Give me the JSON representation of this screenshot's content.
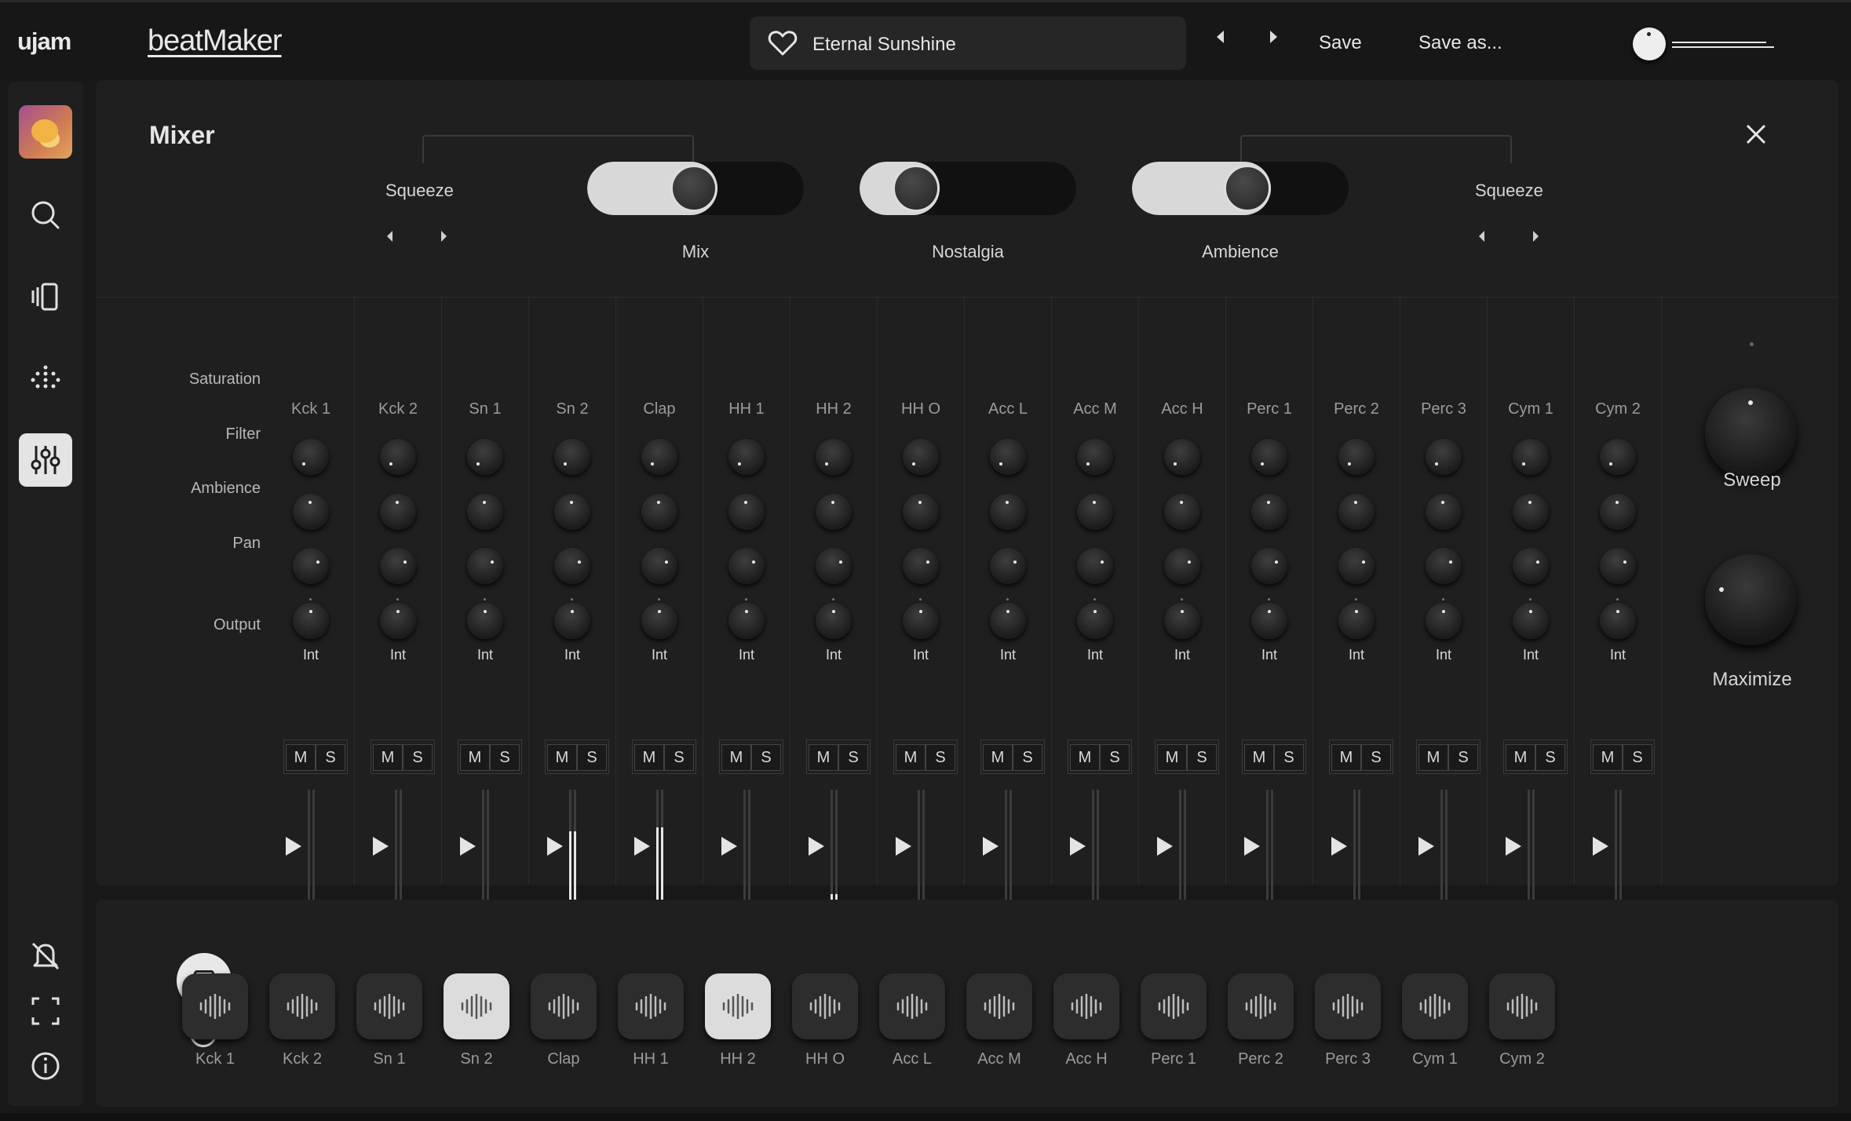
{
  "app": {
    "brand": "ujam",
    "product": "beatMaker"
  },
  "header": {
    "preset_name": "Eternal Sunshine",
    "save_label": "Save",
    "save_as_label": "Save as..."
  },
  "sidebar": {
    "items": [
      "search-icon",
      "library-icon",
      "pattern-icon",
      "mixer-icon"
    ],
    "active": "mixer-icon",
    "bottom_items": [
      "notifications-off-icon",
      "fullscreen-icon",
      "info-icon"
    ]
  },
  "mixer": {
    "title": "Mixer",
    "left_squeeze_label": "Squeeze",
    "right_squeeze_label": "Squeeze",
    "toggles": [
      {
        "label": "Mix",
        "fill_fraction": 0.5
      },
      {
        "label": "Nostalgia",
        "fill_fraction": 0.2
      },
      {
        "label": "Ambience",
        "fill_fraction": 0.55
      }
    ],
    "row_labels": {
      "saturation": "Saturation",
      "filter": "Filter",
      "ambience": "Ambience",
      "pan": "Pan",
      "output": "Output"
    },
    "mute_label": "M",
    "solo_label": "S",
    "channels": [
      {
        "name": "Kck 1",
        "output": "Int",
        "meter": 0.0
      },
      {
        "name": "Kck 2",
        "output": "Int",
        "meter": 0.0
      },
      {
        "name": "Sn 1",
        "output": "Int",
        "meter": 0.0
      },
      {
        "name": "Sn 2",
        "output": "Int",
        "meter": 0.62
      },
      {
        "name": "Clap",
        "output": "Int",
        "meter": 0.66
      },
      {
        "name": "HH 1",
        "output": "Int",
        "meter": 0.0
      },
      {
        "name": "HH 2",
        "output": "Int",
        "meter": 0.05
      },
      {
        "name": "HH O",
        "output": "Int",
        "meter": 0.0
      },
      {
        "name": "Acc L",
        "output": "Int",
        "meter": 0.0
      },
      {
        "name": "Acc M",
        "output": "Int",
        "meter": 0.0
      },
      {
        "name": "Acc H",
        "output": "Int",
        "meter": 0.0
      },
      {
        "name": "Perc 1",
        "output": "Int",
        "meter": 0.0
      },
      {
        "name": "Perc 2",
        "output": "Int",
        "meter": 0.0
      },
      {
        "name": "Perc 3",
        "output": "Int",
        "meter": 0.0
      },
      {
        "name": "Cym 1",
        "output": "Int",
        "meter": 0.0
      },
      {
        "name": "Cym 2",
        "output": "Int",
        "meter": 0.0
      }
    ],
    "master": {
      "sweep_label": "Sweep",
      "maximize_label": "Maximize"
    }
  },
  "pads": {
    "active": [
      "Sn 2",
      "HH 2"
    ],
    "labels": [
      "Kck 1",
      "Kck 2",
      "Sn 1",
      "Sn 2",
      "Clap",
      "HH 1",
      "HH 2",
      "HH O",
      "Acc L",
      "Acc M",
      "Acc H",
      "Perc 1",
      "Perc 2",
      "Perc 3",
      "Cym 1",
      "Cym 2"
    ]
  }
}
